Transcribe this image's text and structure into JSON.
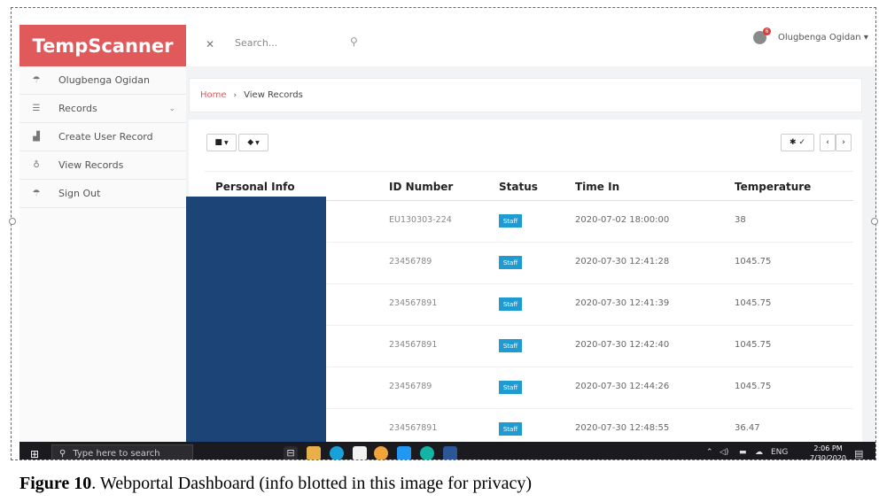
{
  "app": {
    "brand": "TempScanner"
  },
  "header": {
    "search_placeholder": "Search...",
    "notification_count": "6",
    "user_name": "Olugbenga Ogidan",
    "user_caret": "▾"
  },
  "sidebar": {
    "items": [
      {
        "label": "Olugbenga Ogidan",
        "icon": "dashboard-icon"
      },
      {
        "label": "Records",
        "icon": "table-icon"
      },
      {
        "label": "Create User Record",
        "icon": "chart-icon"
      },
      {
        "label": "View Records",
        "icon": "pin-icon"
      },
      {
        "label": "Sign Out",
        "icon": "dashboard-icon"
      }
    ]
  },
  "breadcrumb": {
    "home": "Home",
    "separator": "›",
    "current": "View Records"
  },
  "toolbar": {
    "folder_menu": "▼",
    "tag_menu": "▼",
    "settings_menu": "✓",
    "prev": "‹",
    "next": "›"
  },
  "table": {
    "columns": [
      "Personal Info",
      "ID Number",
      "Status",
      "Time In",
      "Temperature"
    ],
    "rows": [
      {
        "id": "EU130303-224",
        "status": "Staff",
        "time": "2020-07-02 18:00:00",
        "temp": "38"
      },
      {
        "id": "23456789",
        "status": "Staff",
        "time": "2020-07-30 12:41:28",
        "temp": "1045.75"
      },
      {
        "id": "234567891",
        "status": "Staff",
        "time": "2020-07-30 12:41:39",
        "temp": "1045.75"
      },
      {
        "id": "234567891",
        "status": "Staff",
        "time": "2020-07-30 12:42:40",
        "temp": "1045.75"
      },
      {
        "id": "23456789",
        "status": "Staff",
        "time": "2020-07-30 12:44:26",
        "temp": "1045.75"
      },
      {
        "id": "234567891",
        "status": "Staff",
        "time": "2020-07-30 12:48:55",
        "temp": "36.47"
      }
    ]
  },
  "taskbar": {
    "search_placeholder": "Type here to search",
    "language": "ENG",
    "time": "2:06 PM",
    "date": "7/30/2020",
    "notification_count": "3"
  },
  "caption": {
    "label": "Figure 10",
    "text": ". Webportal Dashboard (info blotted in this image for privacy)"
  },
  "colors": {
    "brand": "#e05a5c",
    "badge": "#1f9bd1",
    "redaction": "#1d4477",
    "taskbar": "#1b1b1f"
  }
}
